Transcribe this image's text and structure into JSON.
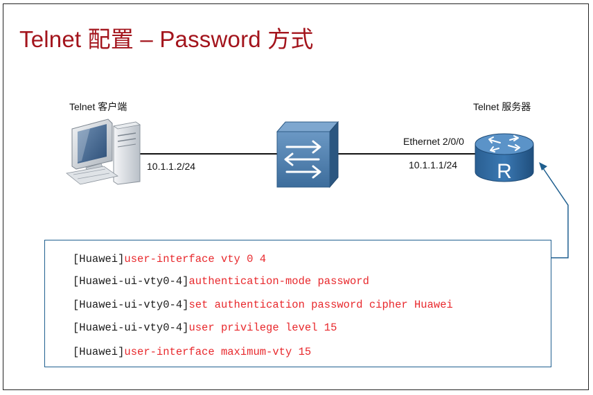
{
  "title": "Telnet 配置 – Password 方式",
  "client": {
    "label": "Telnet 客户端",
    "ip": "10.1.1.2/24"
  },
  "server": {
    "label": "Telnet 服务器",
    "interface": "Ethernet 2/0/0",
    "ip": "10.1.1.1/24",
    "router_letter": "R"
  },
  "icons": {
    "client": "desktop-computer-icon",
    "switch": "switch-icon",
    "server": "router-icon"
  },
  "colors": {
    "title": "#a3141c",
    "command": "#e8282c",
    "prompt": "#1a1a1a",
    "box_border": "#1f5f8f",
    "switch": "#3a6f9e",
    "router": "#2e6b9e"
  },
  "commands": [
    {
      "prompt": "[Huawei]",
      "command": "user-interface vty 0 4"
    },
    {
      "prompt": "[Huawei-ui-vty0-4]",
      "command": "authentication-mode password"
    },
    {
      "prompt": "[Huawei-ui-vty0-4]",
      "command": "set authentication password cipher Huawei"
    },
    {
      "prompt": "[Huawei-ui-vty0-4]",
      "command": "user privilege level 15"
    },
    {
      "prompt": "[Huawei]",
      "command": "user-interface maximum-vty 15"
    }
  ]
}
